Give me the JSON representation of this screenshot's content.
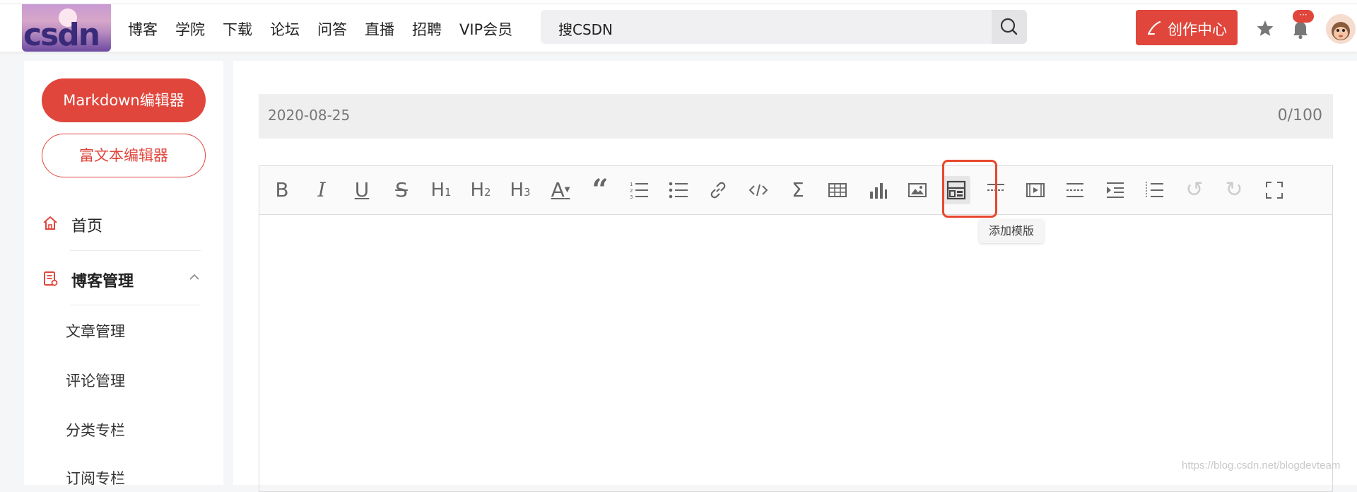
{
  "header": {
    "logo_text": "csdn",
    "nav": [
      "博客",
      "学院",
      "下载",
      "论坛",
      "问答",
      "直播",
      "招聘",
      "VIP会员"
    ],
    "search_placeholder": "搜CSDN",
    "create_label": "创作中心",
    "notification_badge": "···"
  },
  "sidebar": {
    "markdown_button": "Markdown编辑器",
    "richtext_button": "富文本编辑器",
    "home_label": "首页",
    "blog_manage_label": "博客管理",
    "sub_items": [
      "文章管理",
      "评论管理",
      "分类专栏",
      "订阅专栏"
    ]
  },
  "editor": {
    "title_value": "2020-08-25",
    "title_counter": "0/100",
    "tooltip": "添加模版",
    "toolbar": [
      "bold",
      "italic",
      "underline",
      "strikethrough",
      "heading-1",
      "heading-2",
      "heading-3",
      "font-color",
      "quote",
      "ordered-list",
      "unordered-list",
      "link",
      "code",
      "formula",
      "table",
      "chart",
      "image",
      "template",
      "horizontal-rule",
      "video",
      "todo",
      "indent",
      "outdent",
      "undo",
      "redo",
      "fullscreen"
    ]
  },
  "watermark": "https://blog.csdn.net/blogdevteam",
  "colors": {
    "accent": "#e0463c",
    "highlight_border": "#e8472e"
  }
}
